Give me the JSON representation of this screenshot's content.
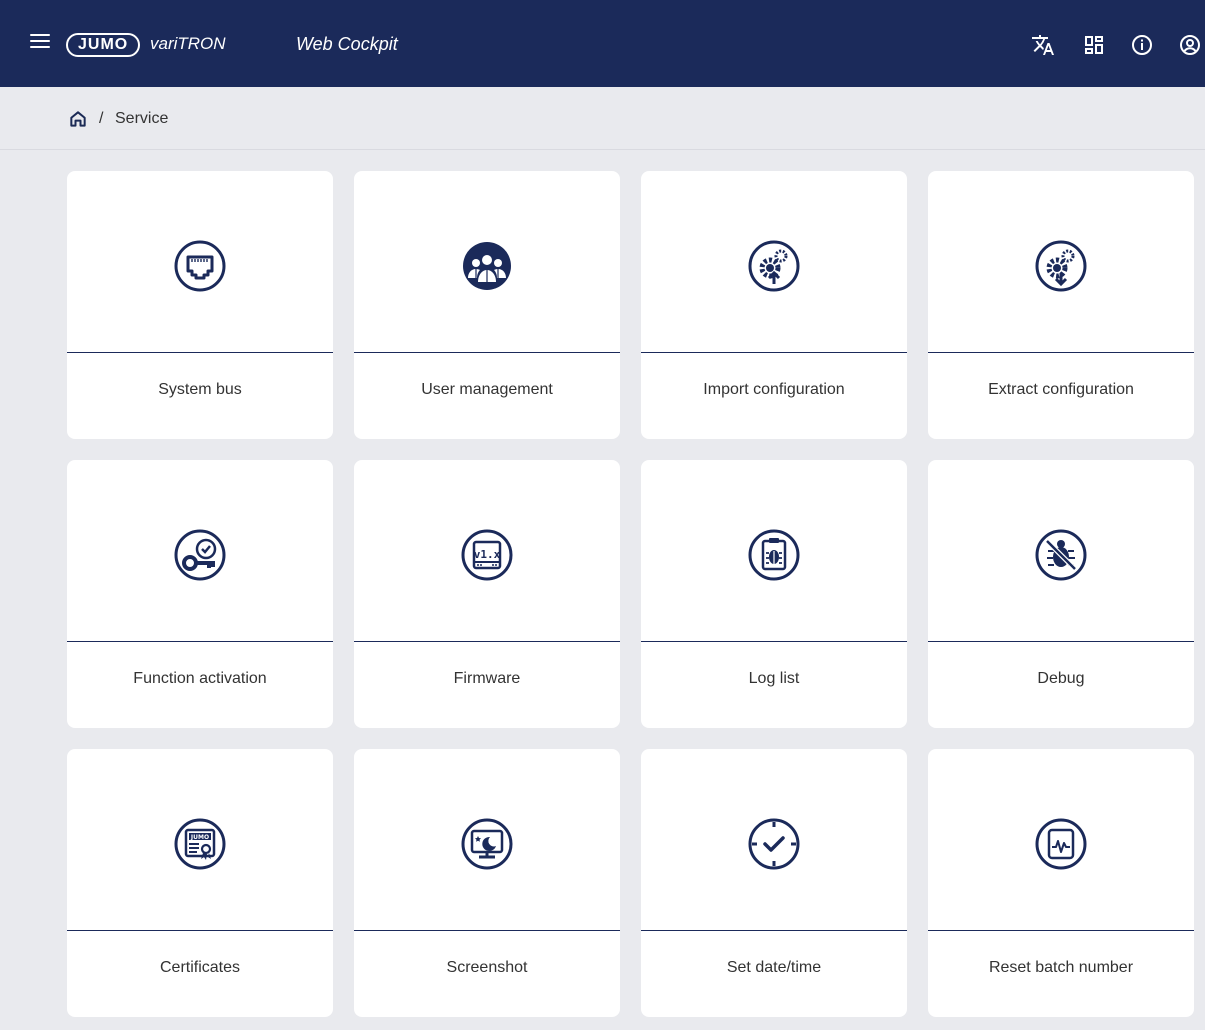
{
  "header": {
    "logo": "JUMO",
    "brand": "variTRON",
    "title": "Web Cockpit",
    "icons": [
      "menu-icon",
      "translate-icon",
      "dashboard-icon",
      "info-icon",
      "account-icon"
    ]
  },
  "breadcrumb": {
    "separator": "/",
    "current": "Service"
  },
  "tiles": [
    {
      "label": "System bus",
      "icon": "ethernet-port-icon"
    },
    {
      "label": "User management",
      "icon": "users-icon"
    },
    {
      "label": "Import configuration",
      "icon": "import-config-icon"
    },
    {
      "label": "Extract configuration",
      "icon": "extract-config-icon"
    },
    {
      "label": "Function activation",
      "icon": "key-clock-icon"
    },
    {
      "label": "Firmware",
      "icon": "firmware-version-icon"
    },
    {
      "label": "Log list",
      "icon": "log-bug-icon"
    },
    {
      "label": "Debug",
      "icon": "debug-off-icon"
    },
    {
      "label": "Certificates",
      "icon": "certificate-icon"
    },
    {
      "label": "Screenshot",
      "icon": "screenshot-icon"
    },
    {
      "label": "Set date/time",
      "icon": "clock-check-icon"
    },
    {
      "label": "Reset batch number",
      "icon": "reset-batch-icon"
    }
  ],
  "colors": {
    "primary": "#1b2a5a",
    "background": "#e9eaee",
    "tile": "#ffffff"
  },
  "certificate_badge_text": "JUMO",
  "firmware_badge_text": "v1.x"
}
